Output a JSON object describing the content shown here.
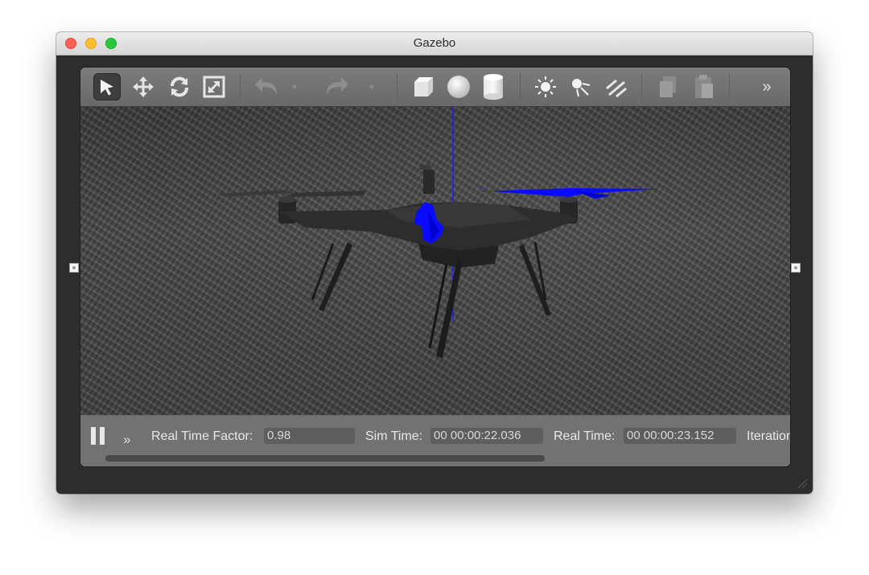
{
  "window": {
    "title": "Gazebo"
  },
  "toolbar": {
    "tools": [
      {
        "icon": "select-arrow-icon",
        "state": "active"
      },
      {
        "icon": "translate-icon"
      },
      {
        "icon": "rotate-icon"
      },
      {
        "icon": "scale-icon"
      },
      {
        "icon": "undo-icon",
        "state": "disabled"
      },
      {
        "icon": "undo-history-dropdown-icon",
        "state": "disabled"
      },
      {
        "icon": "redo-icon",
        "state": "disabled"
      },
      {
        "icon": "redo-history-dropdown-icon",
        "state": "disabled"
      },
      {
        "icon": "box-shape-icon"
      },
      {
        "icon": "sphere-shape-icon"
      },
      {
        "icon": "cylinder-shape-icon"
      },
      {
        "icon": "point-light-icon"
      },
      {
        "icon": "spot-light-icon"
      },
      {
        "icon": "directional-light-icon"
      },
      {
        "icon": "copy-icon",
        "state": "disabled"
      },
      {
        "icon": "paste-icon",
        "state": "disabled"
      },
      {
        "icon": "overflow-chevron-icon"
      }
    ],
    "overflow_glyph": "»"
  },
  "scene": {
    "model": "quadcopter-drone",
    "ground": "asphalt-texture",
    "selection_color": "#0000ff",
    "drone_color": "#2a2a2a"
  },
  "status": {
    "pause_icon": "pause-icon",
    "expand_glyph": "»",
    "real_time_factor_label": "Real Time Factor:",
    "real_time_factor_value": "0.98",
    "sim_time_label": "Sim Time:",
    "sim_time_value": "00 00:00:22.036",
    "real_time_label": "Real Time:",
    "real_time_value": "00 00:00:23.152",
    "iterations_label": "Iteration"
  },
  "colors": {
    "window_bg": "#2d2d2d",
    "toolbar_bg": "#747474",
    "status_bg": "#727272",
    "icon": "#e6e6e6",
    "accent_blue": "#0000ff"
  }
}
